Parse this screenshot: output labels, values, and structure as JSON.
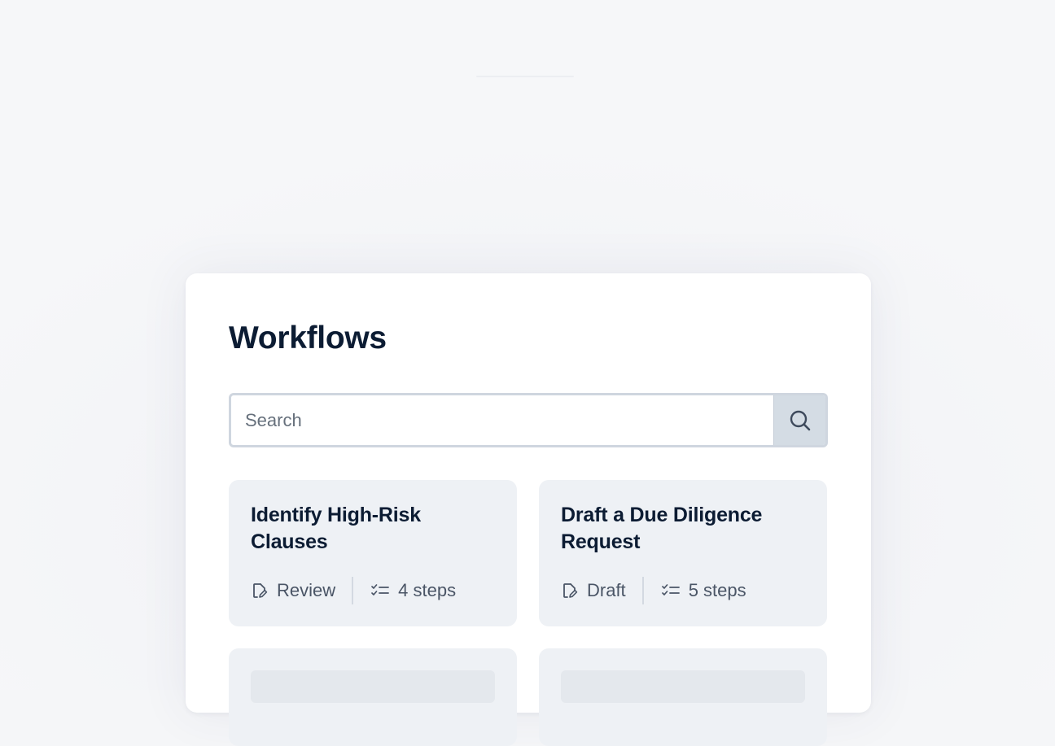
{
  "panel": {
    "title": "Workflows"
  },
  "search": {
    "placeholder": "Search"
  },
  "workflows": [
    {
      "title": "Identify High-Risk Clauses",
      "type": "Review",
      "steps": "4 steps"
    },
    {
      "title": "Draft a Due Diligence Request",
      "type": "Draft",
      "steps": "5 steps"
    }
  ],
  "icons": {
    "search": "search-icon",
    "document": "document-edit-icon",
    "steps": "checklist-icon"
  },
  "colors": {
    "title": "#0c1c33",
    "card_bg": "#eef1f5",
    "search_button_bg": "#d4dce4",
    "meta_text": "#4a5566"
  }
}
